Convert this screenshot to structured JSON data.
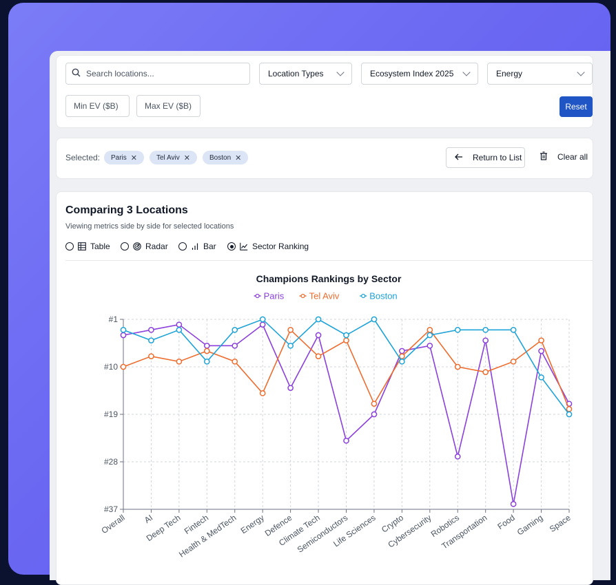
{
  "filters": {
    "search_placeholder": "Search locations...",
    "location_types": "Location Types",
    "ecosystem_index": "Ecosystem Index 2025",
    "sector": "Energy",
    "min_ev_placeholder": "Min EV ($B)",
    "max_ev_placeholder": "Max EV ($B)",
    "reset_label": "Reset"
  },
  "selection": {
    "label": "Selected:",
    "chips": [
      "Paris",
      "Tel Aviv",
      "Boston"
    ],
    "return_label": "Return to List",
    "clear_label": "Clear all"
  },
  "compare": {
    "title": "Comparing 3 Locations",
    "subtitle": "Viewing metrics side by side for selected locations",
    "views": [
      {
        "label": "Table",
        "selected": false
      },
      {
        "label": "Radar",
        "selected": false
      },
      {
        "label": "Bar",
        "selected": false
      },
      {
        "label": "Sector Ranking",
        "selected": true
      }
    ]
  },
  "chart_data": {
    "type": "line",
    "title": "Champions Rankings by Sector",
    "xlabel": "",
    "ylabel": "",
    "y_reversed": true,
    "ylim": [
      1,
      37
    ],
    "y_ticks": [
      1,
      10,
      19,
      28,
      37
    ],
    "y_tick_labels": [
      "#1",
      "#10",
      "#19",
      "#28",
      "#37"
    ],
    "grid": true,
    "legend_position": "top",
    "categories": [
      "Overall",
      "AI",
      "Deep Tech",
      "Fintech",
      "Health & MedTech",
      "Energy",
      "Defence",
      "Climate Tech",
      "Semiconductors",
      "Life Sciences",
      "Crypto",
      "Cybersecurity",
      "Robotics",
      "Transportation",
      "Food",
      "Gaming",
      "Space"
    ],
    "series": [
      {
        "name": "Paris",
        "color": "#8b3fdc",
        "values": [
          4,
          3,
          2,
          6,
          6,
          2,
          14,
          4,
          24,
          19,
          7,
          6,
          27,
          5,
          36,
          7,
          17
        ]
      },
      {
        "name": "Tel Aviv",
        "color": "#ee6c2d",
        "values": [
          10,
          8,
          9,
          7,
          9,
          15,
          3,
          8,
          5,
          17,
          8,
          3,
          10,
          11,
          9,
          5,
          18
        ]
      },
      {
        "name": "Boston",
        "color": "#1ea3d8",
        "values": [
          3,
          5,
          3,
          9,
          3,
          1,
          6,
          1,
          4,
          1,
          9,
          4,
          3,
          3,
          3,
          12,
          19
        ]
      }
    ]
  }
}
